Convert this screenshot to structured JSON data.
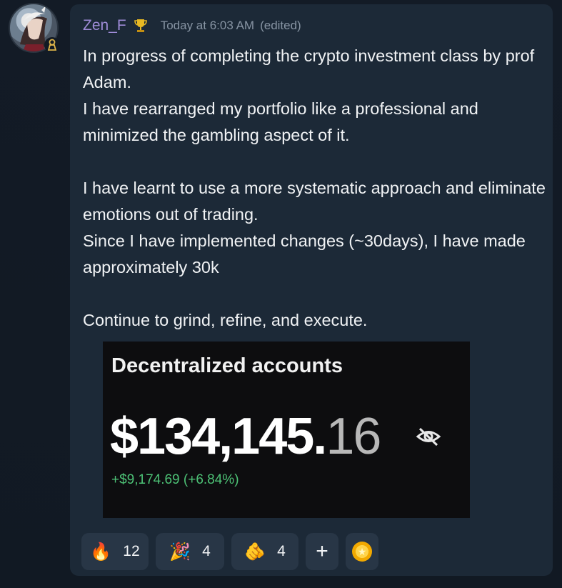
{
  "message": {
    "username": "Zen_F",
    "timestamp": "Today at 6:03 AM",
    "edited": "(edited)",
    "paragraphs": [
      [
        "In progress of completing the crypto investment class by prof Adam.",
        "I have rearranged my portfolio like a professional and minimized the gambling aspect of it."
      ],
      [
        "I have learnt to use a more systematic approach and eliminate emotions out of trading.",
        "Since I have implemented changes (~30days), I have made approximately 30k"
      ],
      [
        "Continue to grind, refine, and execute."
      ]
    ]
  },
  "attachment": {
    "title": "Decentralized accounts",
    "amount_main": "$134,145.",
    "amount_cents": "16",
    "change": "+$9,174.69  (+6.84%)",
    "icon": "eye-off-icon"
  },
  "reactions": [
    {
      "emoji": "🔥",
      "count": "12",
      "icon": "fire-icon"
    },
    {
      "emoji": "🎉",
      "count": "4",
      "icon": "party-popper-icon"
    },
    {
      "emoji": "🫵",
      "count": "4",
      "icon": "pointing-hand-icon"
    }
  ],
  "add_reaction_label": "+",
  "colors": {
    "username": "#9e8bd6",
    "card": "#1c2937",
    "positive": "#4dc276",
    "coin": "#f2a900"
  }
}
